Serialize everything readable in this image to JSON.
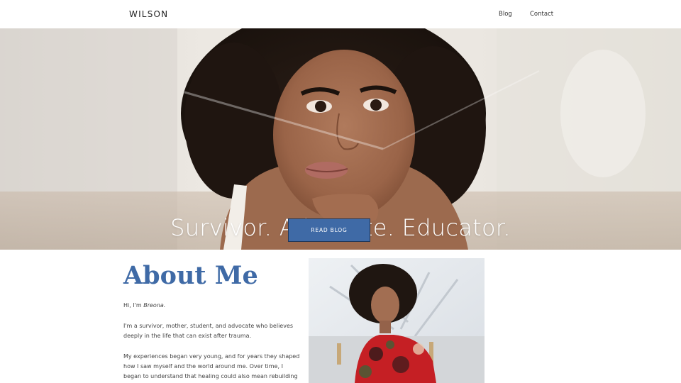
{
  "header": {
    "logo": "WILSON",
    "nav": {
      "blog": "Blog",
      "contact": "Contact"
    }
  },
  "hero": {
    "title": "Survivor. Advocate. Educator.",
    "button_label": "READ BLOG"
  },
  "about": {
    "heading": "About Me",
    "intro_prefix": "Hi, I'm ",
    "intro_name": "Breona.",
    "paragraph_2": "I'm a survivor, mother, student, and advocate who believes deeply in the life that can exist after trauma.",
    "paragraph_3": "My experiences began very young, and for years they shaped how I saw myself and the world around me. Over time, I began to understand that healing could also mean rebuilding confidence,"
  },
  "colors": {
    "accent": "#3f6aa6",
    "button_border": "#22385a",
    "header_bg": "#ffffff"
  }
}
